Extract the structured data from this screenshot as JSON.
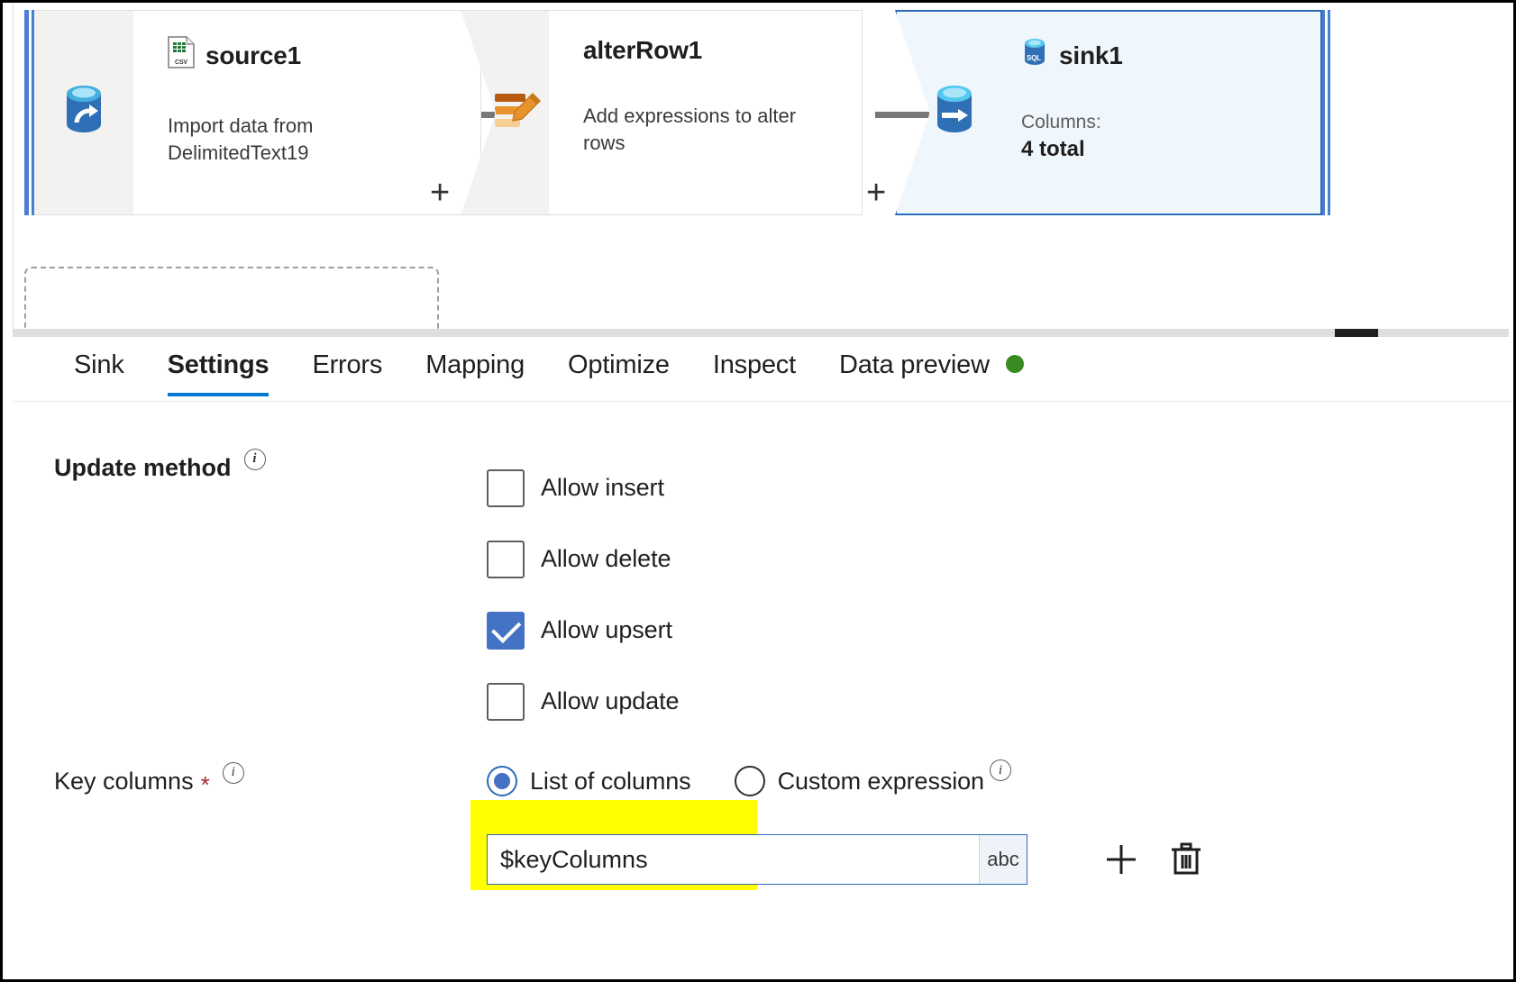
{
  "canvas": {
    "nodes": [
      {
        "id": "source1",
        "title": "source1",
        "icon": "csv-file-icon",
        "stream_icon": "source-database-icon",
        "description": "Import data from DelimitedText19",
        "selected": false
      },
      {
        "id": "alterRow1",
        "title": "alterRow1",
        "icon": "alter-row-edit-icon",
        "description": "Add expressions to alter rows",
        "selected": false
      },
      {
        "id": "sink1",
        "title": "sink1",
        "icon": "sql-database-icon",
        "stream_icon": "sink-database-icon",
        "columns_label": "Columns:",
        "columns_value": "4 total",
        "selected": true
      }
    ],
    "add_handles": [
      "+",
      "+"
    ],
    "selection_color": "#2b6cb8"
  },
  "panel": {
    "tabs": [
      {
        "label": "Sink",
        "active": false,
        "status_dot": false
      },
      {
        "label": "Settings",
        "active": true,
        "status_dot": false
      },
      {
        "label": "Errors",
        "active": false,
        "status_dot": false
      },
      {
        "label": "Mapping",
        "active": false,
        "status_dot": false
      },
      {
        "label": "Optimize",
        "active": false,
        "status_dot": false
      },
      {
        "label": "Inspect",
        "active": false,
        "status_dot": false
      },
      {
        "label": "Data preview",
        "active": false,
        "status_dot": true
      }
    ],
    "active_tab_underline_color": "#0078d4",
    "status_dot_color": "#3a8a22",
    "settings": {
      "update_method": {
        "label": "Update method",
        "info_icon": "info-icon",
        "options": [
          {
            "label": "Allow insert",
            "checked": false
          },
          {
            "label": "Allow delete",
            "checked": false
          },
          {
            "label": "Allow upsert",
            "checked": true
          },
          {
            "label": "Allow update",
            "checked": false
          }
        ]
      },
      "key_columns": {
        "label": "Key columns",
        "required_marker": "*",
        "info_icon": "info-icon",
        "mode_options": [
          {
            "label": "List of columns",
            "selected": true
          },
          {
            "label": "Custom expression",
            "selected": false,
            "info_icon": "info-icon"
          }
        ],
        "field": {
          "value": "$keyColumns",
          "placeholder": "",
          "type_badge": "abc",
          "highlighted": true,
          "highlight_color": "#ffff00"
        },
        "add_button": "add-column-button",
        "delete_button": "delete-column-button"
      }
    }
  }
}
